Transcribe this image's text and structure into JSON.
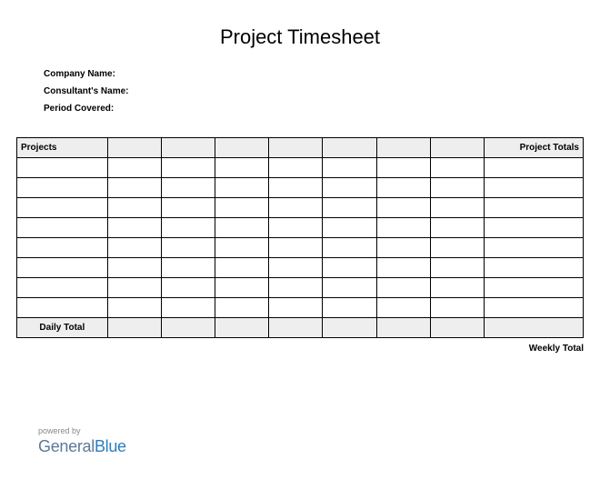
{
  "title": "Project Timesheet",
  "meta": {
    "company_label": "Company Name:",
    "consultant_label": "Consultant's Name:",
    "period_label": "Period Covered:"
  },
  "table": {
    "header_projects": "Projects",
    "header_totals": "Project Totals",
    "daily_total_label": "Daily Total",
    "weekly_total_label": "Weekly Total"
  },
  "footer": {
    "powered": "powered by",
    "brand_general": "General",
    "brand_blue": "Blue"
  }
}
